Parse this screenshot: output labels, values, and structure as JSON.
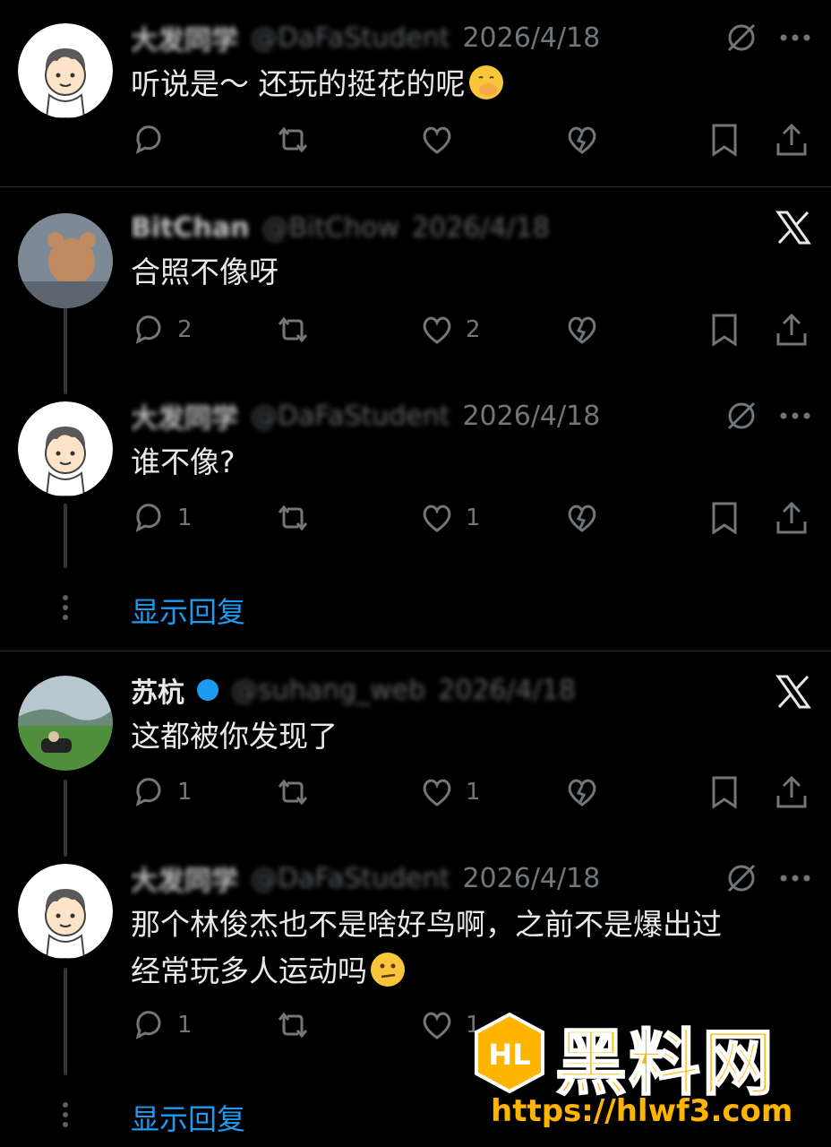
{
  "tweets": [
    {
      "name": "大发同学",
      "handle": "@DaFaStudent",
      "date": "2026/4/18",
      "text": "听说是～ 还玩的挺花的呢",
      "emoji": "hand-over-mouth-emoji",
      "replies": "",
      "likes": "",
      "source": "grok"
    },
    {
      "name": "BitChan",
      "handle": "@BitChow",
      "date": "2026/4/18",
      "text": "合照不像呀",
      "replies": "2",
      "likes": "2",
      "source": "x"
    },
    {
      "name": "大发同学",
      "handle": "@DaFaStudent",
      "date": "2026/4/18",
      "text": "谁不像?",
      "replies": "1",
      "likes": "1",
      "source": "grok"
    },
    {
      "name": "苏杭",
      "handle": "@suhang_web",
      "date": "2026/4/18",
      "text": "这都被你发现了",
      "replies": "1",
      "likes": "1",
      "source": "x"
    },
    {
      "name": "大发同学",
      "handle": "@DaFaStudent",
      "date": "2026/4/18",
      "text_line1": "那个林俊杰也不是啥好鸟啊，之前不是爆出过",
      "text_line2": "经常玩多人运动吗",
      "emoji": "confused-face-emoji",
      "replies": "1",
      "likes": "1",
      "source": "grok"
    }
  ],
  "show_replies_label": "显示回复",
  "watermark": {
    "title": "黑料网",
    "url": "https://hlwf3.com",
    "logo_text": "HL"
  },
  "colors": {
    "background": "#000000",
    "text": "#e7e9ea",
    "muted": "#71767b",
    "accent": "#1d9bf0",
    "watermark": "#ffb400"
  }
}
